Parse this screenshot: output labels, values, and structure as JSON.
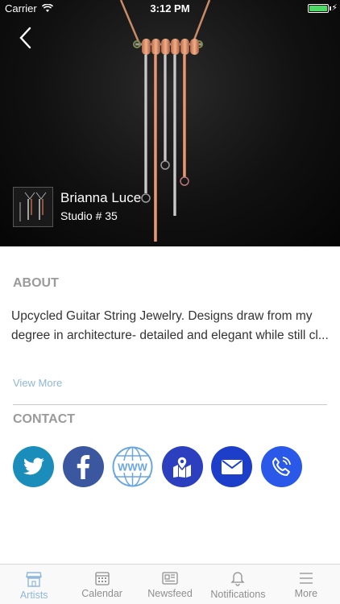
{
  "status_bar": {
    "carrier": "Carrier",
    "time": "3:12 PM"
  },
  "artist": {
    "name": "Brianna Luce",
    "studio": "Studio # 35"
  },
  "about": {
    "title": "ABOUT",
    "line1": "Upcycled Guitar String Jewelry. Designs draw from my",
    "line2": "degree in architecture- detailed and elegant while still cl...",
    "view_more": "View More"
  },
  "contact": {
    "title": "CONTACT",
    "buttons": [
      {
        "icon": "twitter-icon",
        "color": "#1b8dbb"
      },
      {
        "icon": "facebook-icon",
        "color": "#3b57a0"
      },
      {
        "icon": "www-icon",
        "color": "#6aa6e2"
      },
      {
        "icon": "map-icon",
        "color": "#2b3fbf"
      },
      {
        "icon": "email-icon",
        "color": "#1d3ec8"
      },
      {
        "icon": "phone-icon",
        "color": "#2a58e8"
      }
    ]
  },
  "tabs": [
    {
      "label": "Artists",
      "active": true
    },
    {
      "label": "Calendar"
    },
    {
      "label": "Newsfeed"
    },
    {
      "label": "Notifications"
    },
    {
      "label": "More"
    }
  ],
  "colors": {
    "accent": "#8fb7db",
    "section_title": "#9a9a9a",
    "battery": "#4cd964"
  }
}
